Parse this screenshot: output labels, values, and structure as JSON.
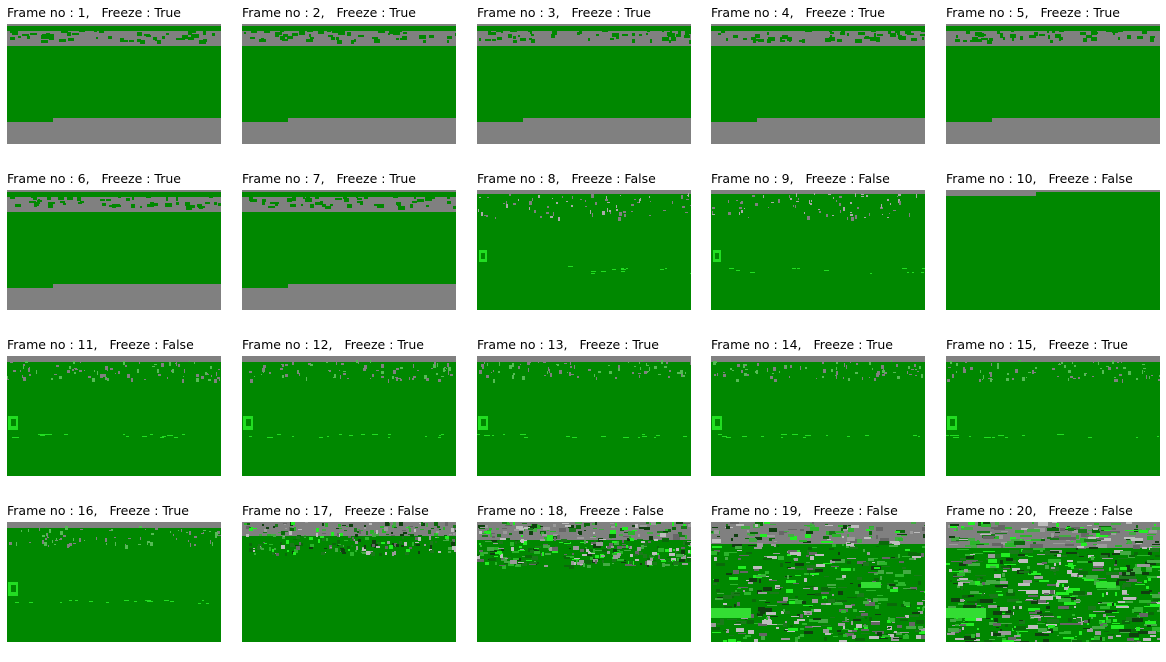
{
  "frames": [
    {
      "label": "Frame no : 1,   Freeze : True",
      "style": "frozenA"
    },
    {
      "label": "Frame no : 2,   Freeze : True",
      "style": "frozenA"
    },
    {
      "label": "Frame no : 3,   Freeze : True",
      "style": "frozenA"
    },
    {
      "label": "Frame no : 4,   Freeze : True",
      "style": "frozenA"
    },
    {
      "label": "Frame no : 5,   Freeze : True",
      "style": "frozenA"
    },
    {
      "label": "Frame no : 6,   Freeze : True",
      "style": "frozenA"
    },
    {
      "label": "Frame no : 7,   Freeze : True",
      "style": "frozenA"
    },
    {
      "label": "Frame no : 8,   Freeze : False",
      "style": "frameB"
    },
    {
      "label": "Frame no : 9,   Freeze : False",
      "style": "frameB"
    },
    {
      "label": "Frame no : 10,   Freeze : False",
      "style": "plain"
    },
    {
      "label": "Frame no : 11,   Freeze : False",
      "style": "frameC"
    },
    {
      "label": "Frame no : 12,   Freeze : True",
      "style": "frameC"
    },
    {
      "label": "Frame no : 13,   Freeze : True",
      "style": "frameC"
    },
    {
      "label": "Frame no : 14,   Freeze : True",
      "style": "frameC"
    },
    {
      "label": "Frame no : 15,   Freeze : True",
      "style": "frameC"
    },
    {
      "label": "Frame no : 16,   Freeze : True",
      "style": "frameC"
    },
    {
      "label": "Frame no : 17,   Freeze : False",
      "style": "noisy1"
    },
    {
      "label": "Frame no : 18,   Freeze : False",
      "style": "noisy2"
    },
    {
      "label": "Frame no : 19,   Freeze : False",
      "style": "noisy3"
    },
    {
      "label": "Frame no : 20,   Freeze : False",
      "style": "noisy4"
    }
  ],
  "colors": {
    "green": "#008800",
    "gray": "#808080",
    "bright": "#22dd22",
    "dark": "#004400"
  }
}
